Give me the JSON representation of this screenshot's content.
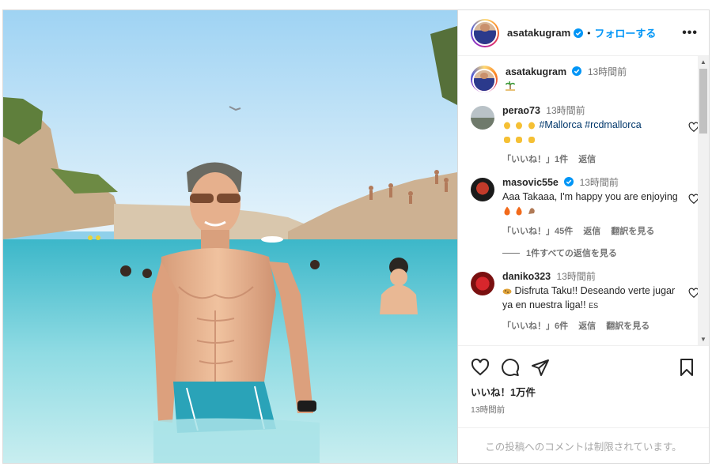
{
  "post": {
    "username": "asatakugram",
    "dot": "•",
    "follow_label": "フォローする",
    "more_label": "•••",
    "caption_time": "13時間前",
    "caption_emoji": "palm-tree-island-emoji"
  },
  "comments": [
    {
      "username": "perao73",
      "time": "13時間前",
      "text_hashtags": "#Mallorca #rcdmallorca",
      "emoji_line1": "clapping-hands-emoji x3",
      "emoji_line2": "raising-hands-emoji x3",
      "like_label": "「いいね！」1件",
      "reply_label": "返信"
    },
    {
      "username": "masovic55e",
      "time": "13時間前",
      "text": "Aaa Takaaa, I'm happy you are enjoying",
      "emoji": "fire fire flexed-biceps",
      "like_label": "「いいね！」45件",
      "reply_label": "返信",
      "translate_label": "翻訳を見る",
      "view_replies": "1件すべての返信を見る"
    },
    {
      "username": "daniko323",
      "time": "13時間前",
      "text": "Disfruta Taku!! Deseando verte jugar ya en nuestra liga!! ",
      "text_suffix": "ES",
      "like_label": "「いいね！」6件",
      "reply_label": "返信",
      "translate_label": "翻訳を見る"
    }
  ],
  "actions": {
    "likes": "いいね！1万件",
    "post_time": "13時間前"
  },
  "footer": {
    "restricted_text": "この投稿へのコメントは制限されています。"
  },
  "colors": {
    "follow_blue": "#0095f6",
    "hashtag": "#00376b",
    "muted": "#737373",
    "border": "#dbdbdb"
  }
}
